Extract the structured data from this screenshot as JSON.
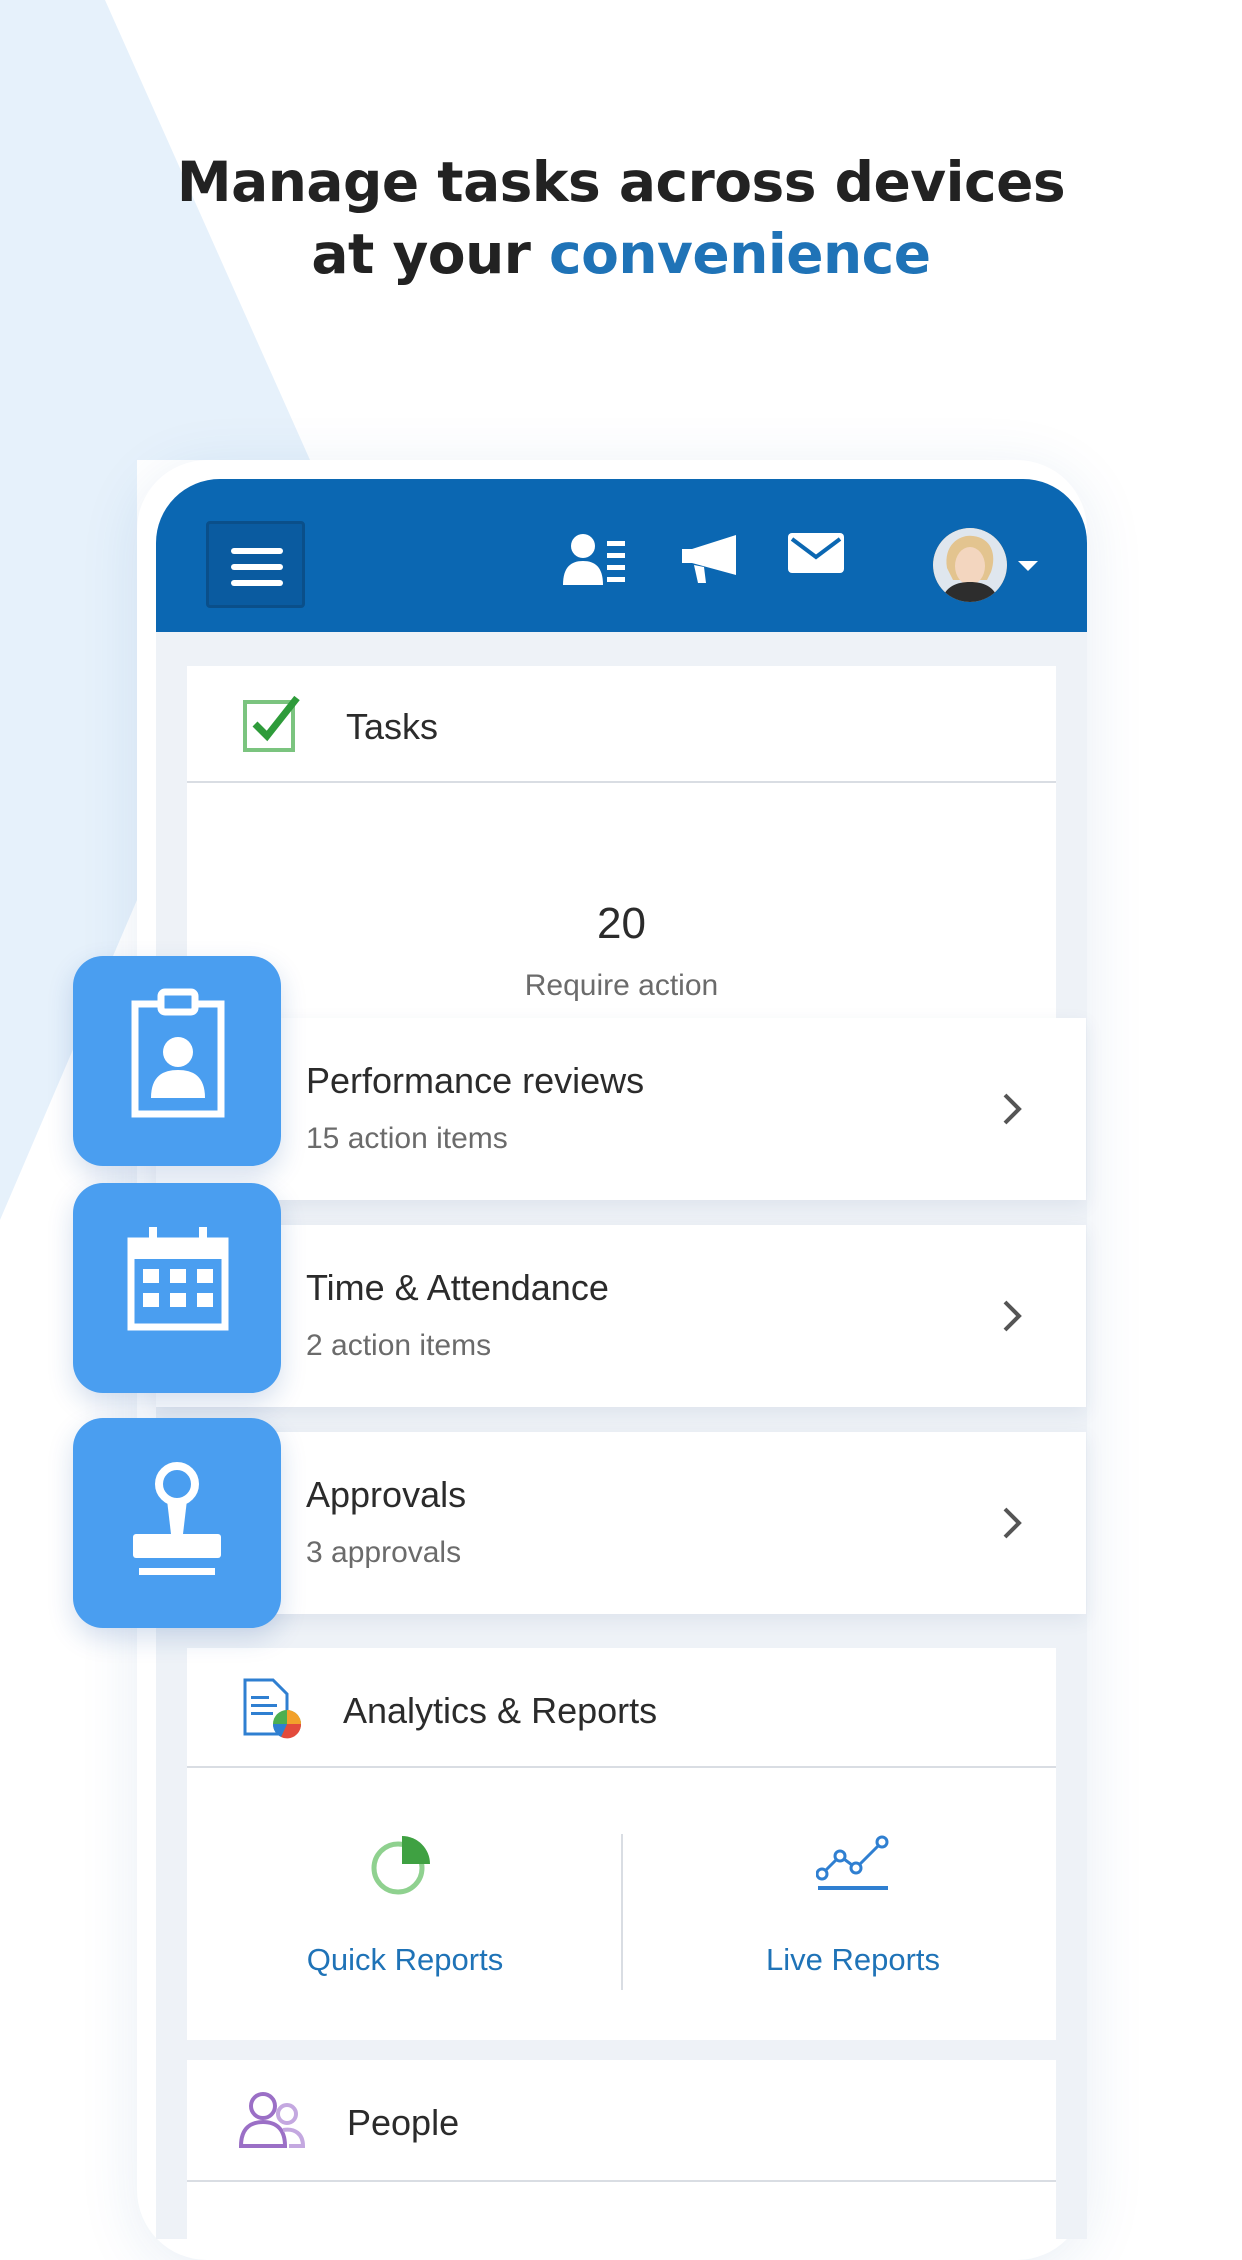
{
  "headline": {
    "line1": "Manage tasks across devices",
    "line2_prefix": "at your ",
    "line2_accent": "convenience"
  },
  "colors": {
    "brand_blue": "#0b67b2",
    "accent_text": "#1f73b7",
    "tile_blue": "#4a9ef0",
    "check_green": "#4caf50",
    "people_purple": "#9b6fc6"
  },
  "app_bar": {
    "menu_icon": "hamburger-menu-icon",
    "icons": [
      "people-directory-icon",
      "announcements-megaphone-icon",
      "messages-envelope-icon"
    ],
    "avatar_icon": "user-avatar",
    "avatar_caret_icon": "caret-down-icon"
  },
  "tasks_card": {
    "title": "Tasks",
    "icon": "checkbox-icon",
    "count": "20",
    "caption": "Require action",
    "items": [
      {
        "title": "Performance reviews",
        "subtitle": "15 action items",
        "icon": "clipboard-badge-icon"
      },
      {
        "title": "Time & Attendance",
        "subtitle": "2 action items",
        "icon": "calendar-icon"
      },
      {
        "title": "Approvals",
        "subtitle": "3 approvals",
        "icon": "stamp-icon"
      }
    ]
  },
  "analytics_card": {
    "title": "Analytics & Reports",
    "icon": "report-document-icon",
    "links": [
      {
        "label": "Quick Reports",
        "icon": "pie-chart-icon"
      },
      {
        "label": "Live Reports",
        "icon": "line-chart-icon"
      }
    ]
  },
  "people_card": {
    "title": "People",
    "icon": "people-icon"
  }
}
